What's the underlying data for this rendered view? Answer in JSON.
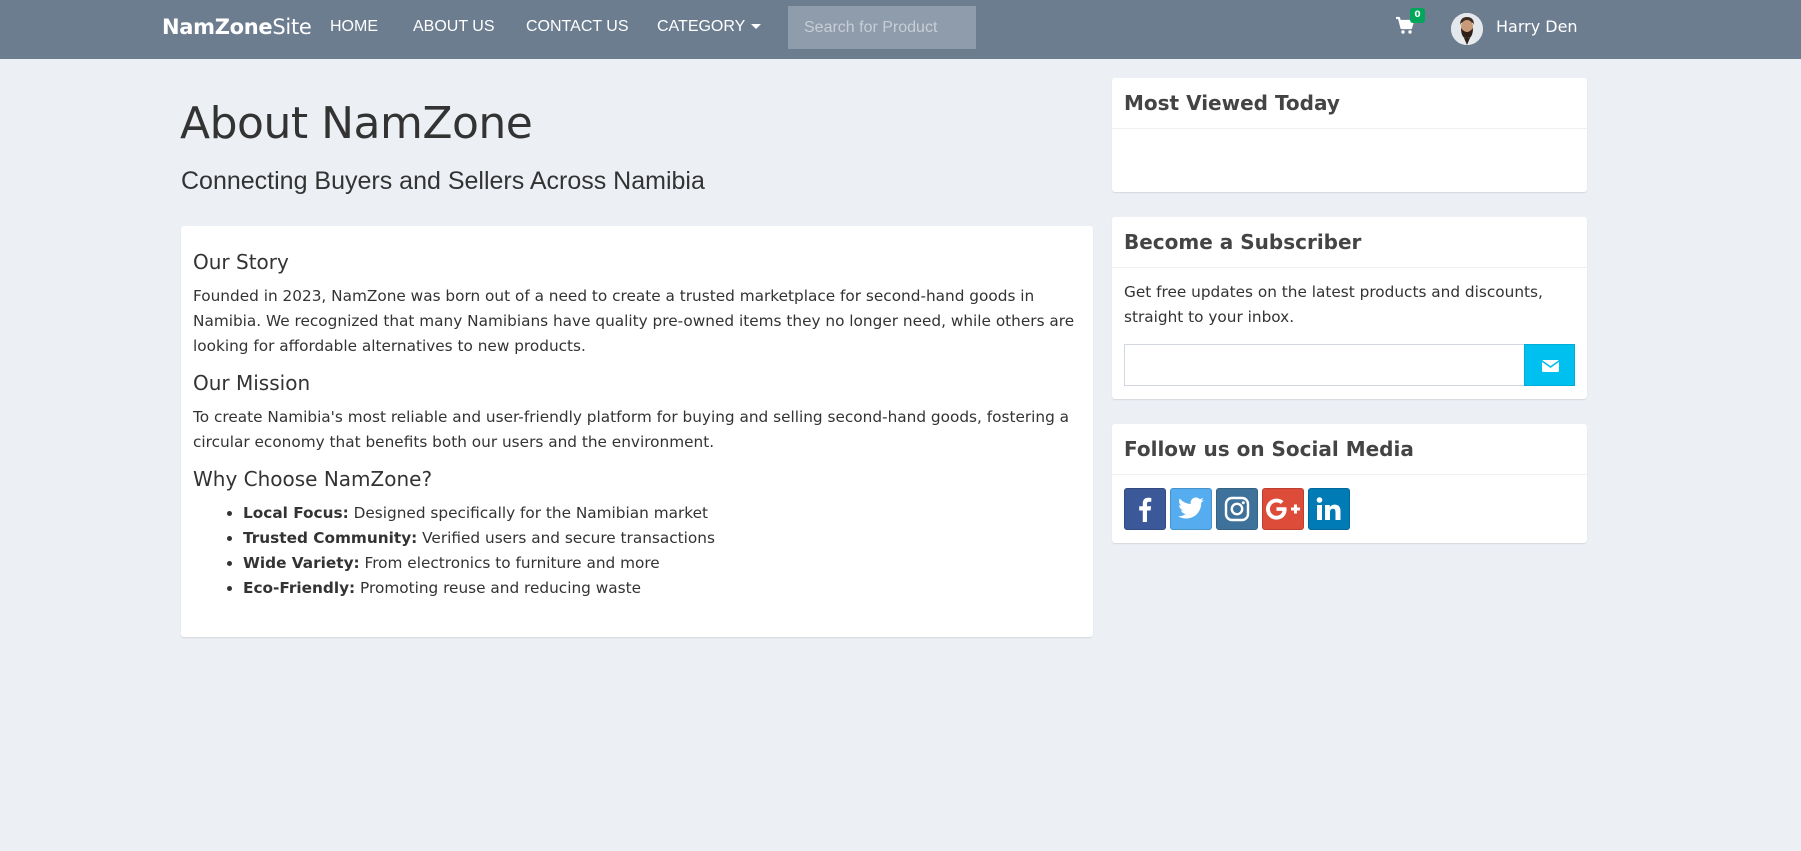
{
  "navbar": {
    "brand_bold": "NamZone",
    "brand_regular": "Site",
    "links": [
      "HOME",
      "ABOUT US",
      "CONTACT US",
      "CATEGORY"
    ],
    "search_placeholder": "Search for Product",
    "cart_count": "0",
    "user_name": "Harry Den"
  },
  "hero": {
    "title": "About NamZone",
    "subtitle": "Connecting Buyers and Sellers Across Namibia"
  },
  "about": {
    "story_title": "Our Story",
    "story_text": "Founded in 2023, NamZone was born out of a need to create a trusted marketplace for second-hand goods in Namibia. We recognized that many Namibians have quality pre-owned items they no longer need, while others are looking for affordable alternatives to new products.",
    "mission_title": "Our Mission",
    "mission_text": "To create Namibia's most reliable and user-friendly platform for buying and selling second-hand goods, fostering a circular economy that benefits both our users and the environment.",
    "why_title": "Why Choose NamZone?",
    "features": [
      {
        "label": "Local Focus:",
        "text": " Designed specifically for the Namibian market"
      },
      {
        "label": "Trusted Community:",
        "text": " Verified users and secure transactions"
      },
      {
        "label": "Wide Variety:",
        "text": " From electronics to furniture and more"
      },
      {
        "label": "Eco-Friendly:",
        "text": " Promoting reuse and reducing waste"
      }
    ]
  },
  "sidebar": {
    "most_viewed_title": "Most Viewed Today",
    "subscribe_title": "Become a Subscriber",
    "subscribe_text": "Get free updates on the latest products and discounts, straight to your inbox.",
    "email_placeholder": "",
    "social_title": "Follow us on Social Media",
    "social_icons": [
      "facebook-icon",
      "twitter-icon",
      "instagram-icon",
      "google-plus-icon",
      "linkedin-icon"
    ]
  },
  "colors": {
    "navbar": "#6c7d90",
    "background": "#ecf0f5",
    "accent": "#00c0ef",
    "badge": "#00a65a",
    "facebook": "#3b5998",
    "twitter": "#55acee",
    "instagram": "#3f729b",
    "google_plus": "#dd4b39",
    "linkedin": "#007bb6"
  }
}
